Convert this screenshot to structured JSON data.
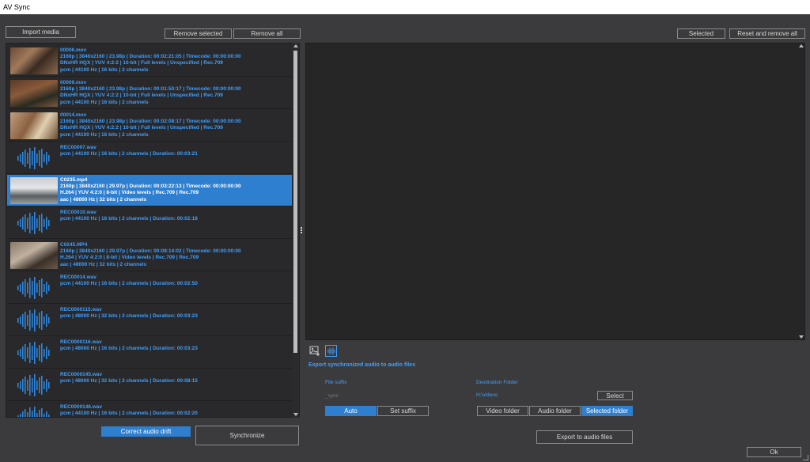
{
  "window": {
    "title": "AV Sync"
  },
  "left_toolbar": {
    "import_label": "Import media",
    "remove_selected_label": "Remove selected",
    "remove_all_label": "Remove all"
  },
  "right_toolbar": {
    "selected_label": "Selected",
    "reset_remove_label": "Reset and remove all"
  },
  "media_items": [
    {
      "kind": "video",
      "thumb": "v0",
      "name": "00006.mov",
      "line1": "2160p | 3840x2160 | 23.98p  | Duration:  00:02:21:05 | Timecode: 00:00:00:00",
      "line2": "DNxHR HQX | YUV 4:2:2 | 10-bit | Full levels | Unspecified | Rec.709",
      "line3": "pcm | 44100 Hz | 16 bits | 2 channels"
    },
    {
      "kind": "video",
      "thumb": "v1",
      "name": "00009.mov",
      "line1": "2160p | 3840x2160 | 23.98p  | Duration:  00:01:50:17 | Timecode: 00:00:00:00",
      "line2": "DNxHR HQX | YUV 4:2:2 | 10-bit | Full levels | Unspecified | Rec.709",
      "line3": "pcm | 44100 Hz | 16 bits | 2 channels"
    },
    {
      "kind": "video",
      "thumb": "v2",
      "name": "00014.mov",
      "line1": "2160p | 3840x2160 | 23.98p  | Duration:  00:02:08:17 | Timecode: 00:00:00:00",
      "line2": "DNxHR HQX | YUV 4:2:2 | 10-bit | Full levels | Unspecified | Rec.709",
      "line3": "pcm | 44100 Hz | 16 bits | 2 channels"
    },
    {
      "kind": "audio",
      "name": "REC00007.wav",
      "line1": "pcm | 44100 Hz | 16 bits | 2 channels | Duration: 00:03:21"
    },
    {
      "kind": "video",
      "thumb": "v3",
      "selected": true,
      "name": "C0235.mp4",
      "line1": "2160p | 3840x2160 | 29.97p  | Duration:  00:03:22:13 | Timecode: 00:00:00:00",
      "line2": "H.264 | YUV 4:2:0 | 8-bit | Video levels | Rec.709 | Rec.709",
      "line3": "aac | 48000 Hz | 32 bits | 2 channels"
    },
    {
      "kind": "audio",
      "name": "REC00010.wav",
      "line1": "pcm | 44100 Hz | 16 bits | 2 channels | Duration: 00:02:18"
    },
    {
      "kind": "video",
      "thumb": "v4",
      "name": "C0245.MP4",
      "line1": "2160p | 3840x2160 | 29.97p  | Duration:  00:08:14:02 | Timecode: 00:00:00:00",
      "line2": "H.264 | YUV 4:2:0 | 8-bit | Video levels | Rec.709 | Rec.709",
      "line3": "aac | 48000 Hz | 32 bits | 2 channels"
    },
    {
      "kind": "audio",
      "name": "REC00014.wav",
      "line1": "pcm | 44100 Hz | 16 bits | 2 channels | Duration: 00:02:50"
    },
    {
      "kind": "audio",
      "name": "REC0000115.wav",
      "line1": "pcm | 48000 Hz | 32 bits | 2 channels | Duration: 00:03:23"
    },
    {
      "kind": "audio",
      "name": "REC0000116.wav",
      "line1": "pcm | 48000 Hz | 16 bits | 2 channels | Duration: 00:03:23"
    },
    {
      "kind": "audio",
      "name": "REC0000145.wav",
      "line1": "pcm | 48000 Hz | 32 bits | 2 channels | Duration: 00:08:15"
    },
    {
      "kind": "audio",
      "name": "REC0000146.wav",
      "line1": "pcm | 44100 Hz | 16 bits | 2 channels | Duration: 00:02:20"
    }
  ],
  "bottom_left": {
    "correct_drift_label": "Correct audio drift",
    "synchronize_label": "Synchronize"
  },
  "export": {
    "heading": "Export synchronized audio to audio files",
    "file_suffix_label": "File suffix",
    "suffix_value": "_sync",
    "auto_label": "Auto",
    "set_suffix_label": "Set suffix",
    "dest_label": "Destination Folder",
    "dest_path": "H:\\videos",
    "select_label": "Select",
    "video_folder_label": "Video folder",
    "audio_folder_label": "Audio folder",
    "selected_folder_label": "Selected folder",
    "export_label": "Export to audio files"
  },
  "ok_label": "Ok",
  "colors": {
    "accent": "#2f7fd0",
    "text_blue": "#3ea0ff",
    "background": "#3b3b3d"
  }
}
